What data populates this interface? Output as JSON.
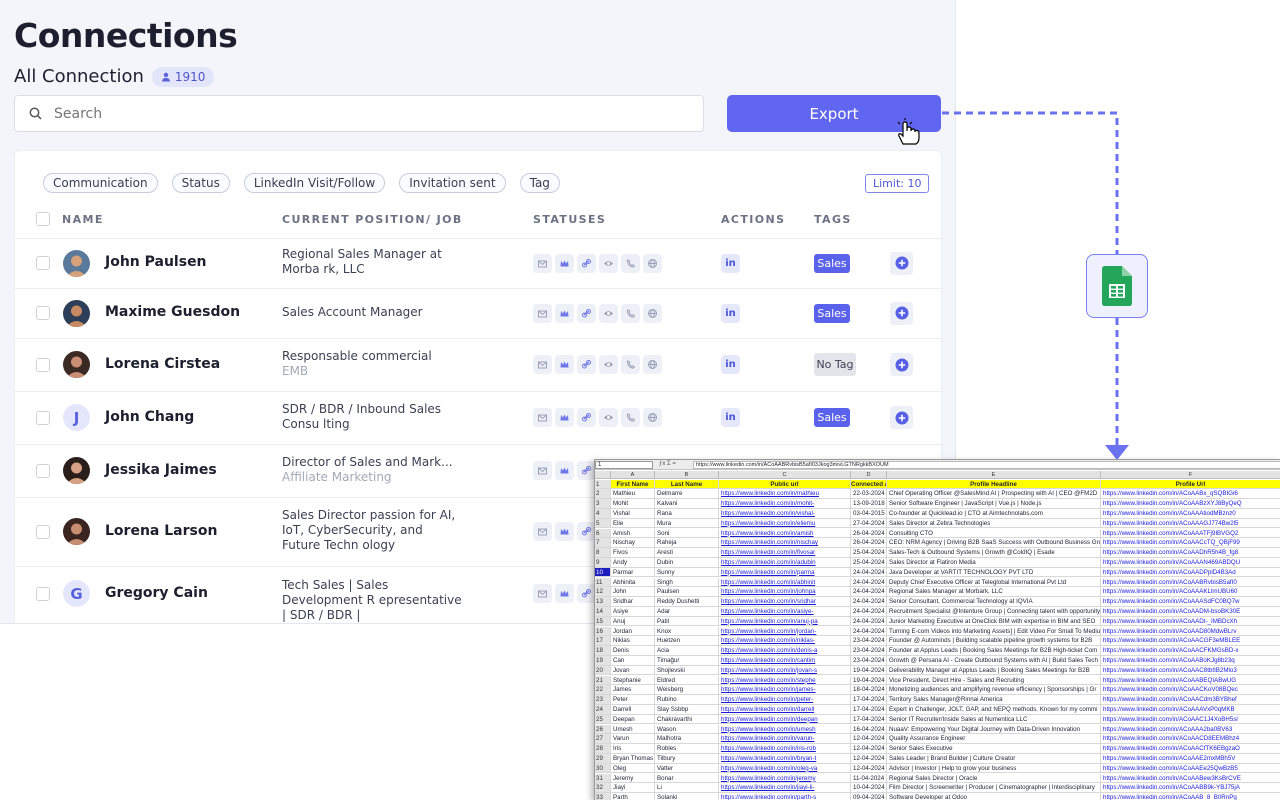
{
  "page": {
    "title": "Connections",
    "subtitle": "All Connection",
    "count": "1910"
  },
  "search": {
    "placeholder": "Search"
  },
  "export": {
    "label": "Export"
  },
  "filters": [
    "Communication",
    "Status",
    "LinkedIn Visit/Follow",
    "Invitation sent",
    "Tag"
  ],
  "limit": "Limit: 10",
  "columns": {
    "name": "NAME",
    "position": "CURRENT POSITION/ JOB",
    "statuses": "STATUSES",
    "actions": "ACTIONS",
    "tags": "TAGS"
  },
  "rows": [
    {
      "name": "John Paulsen",
      "position": "Regional Sales Manager at Morba rk, LLC",
      "company": "",
      "tag": "Sales",
      "avatar": "photo"
    },
    {
      "name": "Maxime Guesdon",
      "position": "Sales Account Manager",
      "company": "",
      "tag": "Sales",
      "avatar": "photo"
    },
    {
      "name": "Lorena Cirstea",
      "position": "Responsable commercial",
      "company": "EMB",
      "tag": "No Tag",
      "avatar": "photo"
    },
    {
      "name": "John Chang",
      "position": "SDR / BDR / Inbound Sales Consu lting",
      "company": "",
      "tag": "Sales",
      "avatar": "J"
    },
    {
      "name": "Jessika Jaimes",
      "position": "Director of Sales and Mark...",
      "company": "Affiliate Marketing",
      "tag": "",
      "avatar": "photo"
    },
    {
      "name": "Lorena Larson",
      "position": "Sales Director passion for AI, IoT, CyberSecurity, and Future Techn ology",
      "company": "",
      "tag": "",
      "avatar": "photo"
    },
    {
      "name": "Gregory Cain",
      "position": "Tech Sales | Sales Development R epresentative | SDR / BDR |",
      "company": "",
      "tag": "",
      "avatar": "G"
    }
  ],
  "icons": {
    "search": "search-icon",
    "statuses": [
      "mail-icon",
      "crown-icon",
      "link-icon",
      "eye-icon",
      "phone-icon",
      "globe-icon"
    ],
    "linkedin": "linkedin-icon",
    "add": "plus-circle-icon",
    "sheets": "google-sheets-icon",
    "cursor": "hand-cursor-icon"
  },
  "colors": {
    "accent": "#6066f0",
    "arrow": "#6b72f0",
    "sheets_green": "#23a55a",
    "header_yellow": "#ffff00"
  },
  "spreadsheet": {
    "cell_ref": "1",
    "formula": "https://www.linkedin.com/in/ACoAABRvbisB5afI03Jkog3mivLGTNRgkkBXOUM",
    "column_letters": [
      "A",
      "B",
      "C",
      "D",
      "E",
      "F"
    ],
    "headers": [
      "First Name",
      "Last Name",
      "Public url",
      "Connected At",
      "Profile Headline",
      "Profile Url"
    ],
    "rows": [
      [
        "Mathieu",
        "Delmarre",
        "https://www.linkedin.com/in/mathieu",
        "22-03-2024",
        "Chief Operating Officer @SalesMind AI | Prospecting with AI | CEO @FM2D",
        "https://www.linkedin.com/in/ACoAABx_qSQBIGi6"
      ],
      [
        "Mohit",
        "Kalvani",
        "https://www.linkedin.com/in/mohit-",
        "13-09-2018",
        "Senior Software Engineer | JavaScript | Vue.js | Node.js",
        "https://www.linkedin.com/in/ACoAABzXYJ8ByQeQ"
      ],
      [
        "Vishal",
        "Rana",
        "https://www.linkedin.com/in/vishal-",
        "03-04-2015",
        "Co-founder at Quicklead.io | CTO at Aimtechnolabs.com",
        "https://www.linkedin.com/in/ACoAAAtiodMBznz0"
      ],
      [
        "Elie",
        "Mura",
        "https://www.linkedin.com/in/eliemu",
        "27-04-2024",
        "Sales Director at Zebra Technologies",
        "https://www.linkedin.com/in/ACoAAAGJ774Bw2l5"
      ],
      [
        "Amish",
        "Soni",
        "https://www.linkedin.com/in/amish",
        "26-04-2024",
        "Consulting CTO",
        "https://www.linkedin.com/in/ACoAAATFj9IBVGQ2"
      ],
      [
        "Nischay",
        "Raheja",
        "https://www.linkedin.com/in/nischay",
        "26-04-2024",
        "CEO: NRM Agency | Driving B2B SaaS Success with Outbound Business Growth",
        "https://www.linkedin.com/in/ACoAACcTQ_QBjF99"
      ],
      [
        "Fivos",
        "Aresti",
        "https://www.linkedin.com/in/fivosar",
        "25-04-2024",
        "Sales-Tech & Outbound Systems  | Growth @ColdIQ | Esade",
        "https://www.linkedin.com/in/ACoAADhR5h4B_fg8"
      ],
      [
        "Andy",
        "Dubin",
        "https://www.linkedin.com/in/adubin",
        "25-04-2024",
        "Sales Director at Flatiron Media",
        "https://www.linkedin.com/in/ACoAAAN469ABDQU"
      ],
      [
        "Parmar",
        "Sunny",
        "https://www.linkedin.com/in/parma",
        "24-04-2024",
        "Java Developer at VARTIT TECHNOLOGY PVT LTD",
        "https://www.linkedin.com/in/ACoAADPplD4B3Ad"
      ],
      [
        "Abhinita",
        "Singh",
        "https://www.linkedin.com/in/abhinit",
        "24-04-2024",
        "Deputy Chief Executive Officer at Teleglobal International Pvt Ltd",
        "https://www.linkedin.com/in/ACoAABRvbisB5afI0"
      ],
      [
        "John",
        "Paulsen",
        "https://www.linkedin.com/in/johnpa",
        "24-04-2024",
        "Regional Sales Manager at Morbark, LLC",
        "https://www.linkedin.com/in/ACoAAAKLlmUBU60"
      ],
      [
        "Sridhar",
        "Reddy Dushetti",
        "https://www.linkedin.com/in/sridhar",
        "24-04-2024",
        "Senior Consultant, Commercial Technology at IQVIA",
        "https://www.linkedin.com/in/ACoAAASdFC0BQ7w"
      ],
      [
        "Asiye",
        "Adar",
        "https://www.linkedin.com/in/asiye-",
        "24-04-2024",
        "Recruitment Specialist @Intenture Group | Connecting talent with opportunity",
        "https://www.linkedin.com/in/ACoAADM-bsoBK30E"
      ],
      [
        "Anuj",
        "Patil",
        "https://www.linkedin.com/in/anuj-pa",
        "24-04-2024",
        "Junior Marketing Executive at OneClick BIM with expertise in BIM and SEO",
        "https://www.linkedin.com/in/ACoAADt-_IMBDcXh"
      ],
      [
        "Jordan",
        "Knox",
        "https://www.linkedin.com/in/jordan-",
        "24-04-2024",
        "Turning E-com Videos into Marketing Assets] | Edit Video For Small To Medium",
        "https://www.linkedin.com/in/ACoAAD80MdwBLrv"
      ],
      [
        "Niklas",
        "Huetzen",
        "https://www.linkedin.com/in/niklas-",
        "23-04-2024",
        "Founder @ Autominds | Building scalable pipeline growth systems for B2B",
        "https://www.linkedin.com/in/ACoAACGF3eMBLEE"
      ],
      [
        "Denis",
        "Acia",
        "https://www.linkedin.com/in/denis-a",
        "23-04-2024",
        "Founder at Applus Leads | Booking Sales Meetings for B2B High-ticket Com",
        "https://www.linkedin.com/in/ACoAACFKMGsBD-x"
      ],
      [
        "Can",
        "Timağur",
        "https://www.linkedin.com/in/cantim",
        "23-04-2024",
        "Growth @ Persana AI - Create Outbound Systems with AI | Build Sales Tech",
        "https://www.linkedin.com/in/ACoAABoKJg8b23q"
      ],
      [
        "Jovan",
        "Shojlevski",
        "https://www.linkedin.com/in/jovan-s",
        "19-04-2024",
        "Deliverability Manager at Applus Leads | Booking Sales Meetings for B2B",
        "https://www.linkedin.com/in/ACoAAC8tbtIB2Mlo3"
      ],
      [
        "Stephanie",
        "Eldred",
        "https://www.linkedin.com/in/stephe",
        "19-04-2024",
        "Vice President, Direct Hire - Sales and Recruiting",
        "https://www.linkedin.com/in/ACoAABEQIABwUG"
      ],
      [
        "James",
        "Weisberg",
        "https://www.linkedin.com/in/james-",
        "18-04-2024",
        "Monetizing audiences and amplifying revenue efficiency | Sponsorships | Gr",
        "https://www.linkedin.com/in/ACoAACKoV08BQec"
      ],
      [
        "Peter",
        "Rubino",
        "https://www.linkedin.com/in/peter-",
        "17-04-2024",
        "Territory Sales Manager@Rinnai America",
        "https://www.linkedin.com/in/ACoAACdm3BYBhef"
      ],
      [
        "Darrell",
        "Slay Ssbbp",
        "https://www.linkedin.com/in/darrell",
        "17-04-2024",
        "Expert in Challenger, JOLT, GAP, and NEPQ methods. Known for my commi",
        "https://www.linkedin.com/in/ACoAAAVxP0qMKB"
      ],
      [
        "Deepan",
        "Chakravarthi",
        "https://www.linkedin.com/in/deepan",
        "17-04-2024",
        "Senior IT Recruiter/Inside Sales at Numentica LLC",
        "https://www.linkedin.com/in/ACoAAC1J4XoBH5sl"
      ],
      [
        "Umesh",
        "Wason",
        "https://www.linkedin.com/in/umesh",
        "16-04-2024",
        "NuaaV: Empowering Your Digital Journey with Data-Driven Innovation",
        "https://www.linkedin.com/in/ACoAAA2ba0BV63"
      ],
      [
        "Varun",
        "Malhotra",
        "https://www.linkedin.com/in/varun-",
        "12-04-2024",
        "Quality Assurance Engineer",
        "https://www.linkedin.com/in/ACoAACD8EEMBhz4"
      ],
      [
        "Iris",
        "Robles",
        "https://www.linkedin.com/in/iris-rob",
        "12-04-2024",
        "Senior Sales Executive",
        "https://www.linkedin.com/in/ACoAACfTK6EBgzaO"
      ],
      [
        "Bryan Thomas",
        "Tilbury",
        "https://www.linkedin.com/in/bryan-t",
        "12-04-2024",
        "Sales Leader | Brand Builder | Culture Creator",
        "https://www.linkedin.com/in/ACoAAE2mxMBh5V"
      ],
      [
        "Oleg",
        "Vatter",
        "https://www.linkedin.com/in/oleg-va",
        "12-04-2024",
        "Advisor | Investor | Help to grow your business",
        "https://www.linkedin.com/in/ACoAAEe25QwBzB5"
      ],
      [
        "Jeremy",
        "Bonar",
        "https://www.linkedin.com/in/jeremy",
        "11-04-2024",
        "Regional Sales Director | Oracle",
        "https://www.linkedin.com/in/ACoAABew3KsBrCVE"
      ],
      [
        "Jiayi",
        "Li",
        "https://www.linkedin.com/in/jiayi-li-",
        "10-04-2024",
        "Film Director | Screenwriter | Producer | Cinematographer | Interdisciplinary",
        "https://www.linkedin.com/in/ACoAABB9k-YBJ75jA"
      ],
      [
        "Parth",
        "Solanki",
        "https://www.linkedin.com/in/parth-s",
        "09-04-2024",
        "Software Developer at Odoo",
        "https://www.linkedin.com/in/ACoAAB_8_B0RnPg"
      ]
    ]
  }
}
